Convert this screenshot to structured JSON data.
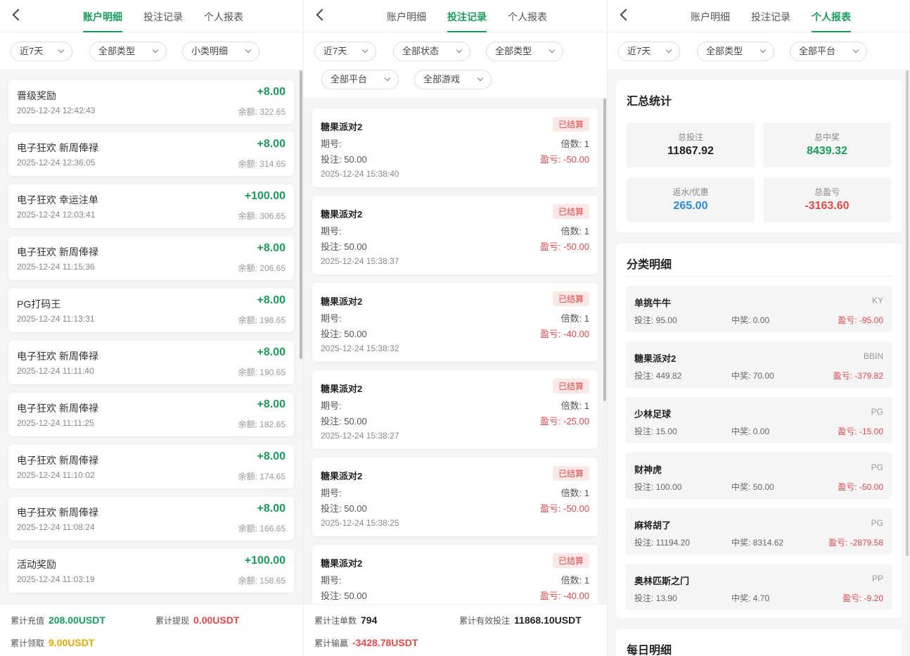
{
  "colors": {
    "accent": "#1a9b5a",
    "loss": "#e04a4a",
    "blue": "#2a8ad8",
    "gold": "#e0a800"
  },
  "tabs": [
    "账户明细",
    "投注记录",
    "个人报表"
  ],
  "panel1": {
    "filters": [
      "近7天",
      "全部类型",
      "小类明细"
    ],
    "balance_prefix": "余额: ",
    "items": [
      {
        "name": "晋级奖励",
        "time": "2025-12-24 12:42:43",
        "amount": "+8.00",
        "balance": "322.65"
      },
      {
        "name": "电子狂欢 新周俸禄",
        "time": "2025-12-24 12:36:05",
        "amount": "+8.00",
        "balance": "314.65"
      },
      {
        "name": "电子狂欢 幸运注单",
        "time": "2025-12-24 12:03:41",
        "amount": "+100.00",
        "balance": "306.65"
      },
      {
        "name": "电子狂欢 新周俸禄",
        "time": "2025-12-24 11:15:36",
        "amount": "+8.00",
        "balance": "206.65"
      },
      {
        "name": "PG打码王",
        "time": "2025-12-24 11:13:31",
        "amount": "+8.00",
        "balance": "198.65"
      },
      {
        "name": "电子狂欢 新周俸禄",
        "time": "2025-12-24 11:11:40",
        "amount": "+8.00",
        "balance": "190.65"
      },
      {
        "name": "电子狂欢 新周俸禄",
        "time": "2025-12-24 11:11:25",
        "amount": "+8.00",
        "balance": "182.65"
      },
      {
        "name": "电子狂欢 新周俸禄",
        "time": "2025-12-24 11:10:02",
        "amount": "+8.00",
        "balance": "174.65"
      },
      {
        "name": "电子狂欢 新周俸禄",
        "time": "2025-12-24 11:08:24",
        "amount": "+8.00",
        "balance": "166.65"
      },
      {
        "name": "活动奖励",
        "time": "2025-12-24 11:03:19",
        "amount": "+100.00",
        "balance": "158.65"
      }
    ],
    "footer": {
      "recharge_label": "累计充值",
      "recharge_value": "208.00USDT",
      "withdraw_label": "累计提现",
      "withdraw_value": "0.00USDT",
      "claim_label": "累计领取",
      "claim_value": "9.00USDT"
    }
  },
  "panel2": {
    "filters": [
      "近7天",
      "全部状态",
      "全部类型",
      "全部平台",
      "全部游戏"
    ],
    "issue_label": "期号:",
    "bet_prefix": "投注: ",
    "mult_prefix": "倍数: ",
    "pl_prefix": "盈亏: ",
    "bets": [
      {
        "game": "糖果派对2",
        "status": "已结算",
        "bet": "50.00",
        "mult": "1",
        "pl": "-50.00",
        "time": "2025-12-24 15:38:40"
      },
      {
        "game": "糖果派对2",
        "status": "已结算",
        "bet": "50.00",
        "mult": "1",
        "pl": "-50.00",
        "time": "2025-12-24 15:38:37"
      },
      {
        "game": "糖果派对2",
        "status": "已结算",
        "bet": "50.00",
        "mult": "1",
        "pl": "-40.00",
        "time": "2025-12-24 15:38:32"
      },
      {
        "game": "糖果派对2",
        "status": "已结算",
        "bet": "50.00",
        "mult": "1",
        "pl": "-25.00",
        "time": "2025-12-24 15:38:27"
      },
      {
        "game": "糖果派对2",
        "status": "已结算",
        "bet": "50.00",
        "mult": "1",
        "pl": "-50.00",
        "time": "2025-12-24 15:38:25"
      },
      {
        "game": "糖果派对2",
        "status": "已结算",
        "bet": "50.00",
        "mult": "1",
        "pl": "-40.00",
        "time": ""
      }
    ],
    "footer": {
      "count_label": "累计注单数",
      "count_value": "794",
      "valid_label": "累计有效投注",
      "valid_value": "11868.10USDT",
      "winloss_label": "累计输赢",
      "winloss_value": "-3428.78USDT"
    }
  },
  "panel3": {
    "filters": [
      "近7天",
      "全部类型",
      "全部平台"
    ],
    "summary_title": "汇总统计",
    "stats": [
      {
        "label": "总投注",
        "value": "11867.92"
      },
      {
        "label": "总中奖",
        "value": "8439.32"
      },
      {
        "label": "返水/优惠",
        "value": "265.00"
      },
      {
        "label": "总盈亏",
        "value": "-3163.60"
      }
    ],
    "category_title": "分类明细",
    "bet_prefix": "投注: ",
    "win_prefix": "中奖: ",
    "pl_prefix": "盈亏: ",
    "categories": [
      {
        "name": "单挑牛牛",
        "platform": "KY",
        "bet": "95.00",
        "win": "0.00",
        "pl": "-95.00"
      },
      {
        "name": "糖果派对2",
        "platform": "BBIN",
        "bet": "449.82",
        "win": "70.00",
        "pl": "-379.82"
      },
      {
        "name": "少林足球",
        "platform": "PG",
        "bet": "15.00",
        "win": "0.00",
        "pl": "-15.00"
      },
      {
        "name": "财神虎",
        "platform": "PG",
        "bet": "100.00",
        "win": "50.00",
        "pl": "-50.00"
      },
      {
        "name": "麻将胡了",
        "platform": "PG",
        "bet": "11194.20",
        "win": "8314.62",
        "pl": "-2879.58"
      },
      {
        "name": "奥林匹斯之门",
        "platform": "PP",
        "bet": "13.90",
        "win": "4.70",
        "pl": "-9.20"
      }
    ],
    "daily_title": "每日明细"
  }
}
